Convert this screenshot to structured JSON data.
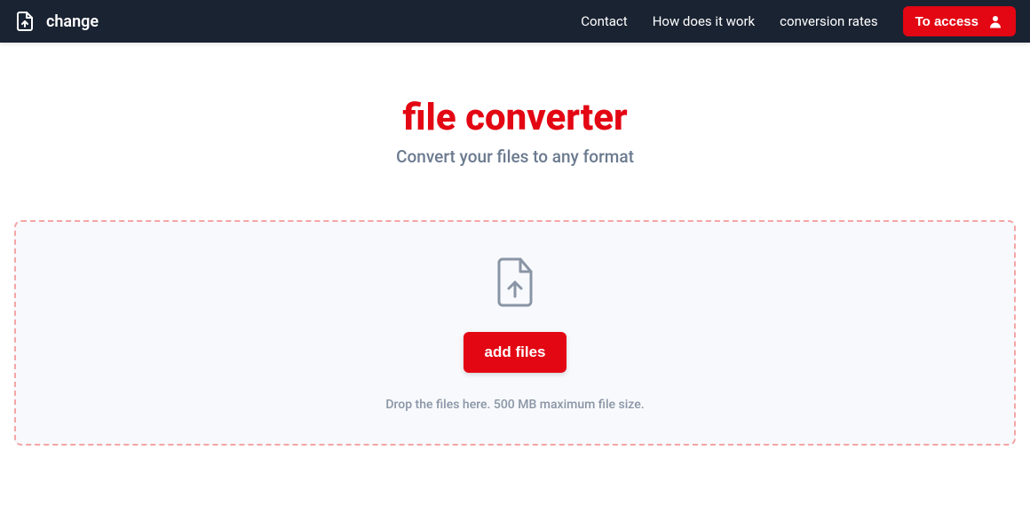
{
  "header": {
    "logo_text": "change",
    "nav": {
      "contact": "Contact",
      "how_it_works": "How does it work",
      "conversion_rates": "conversion rates"
    },
    "access_button": "To access"
  },
  "main": {
    "title": "file converter",
    "subtitle": "Convert your files to any format",
    "dropzone": {
      "add_files_label": "add files",
      "hint": "Drop the files here. 500 MB maximum file size."
    }
  },
  "colors": {
    "primary": "#e30613",
    "header_bg": "#1a2332",
    "text_muted": "#6b7a8f",
    "dropzone_bg": "#f7f9fc",
    "dropzone_border": "#f5a5a5"
  }
}
